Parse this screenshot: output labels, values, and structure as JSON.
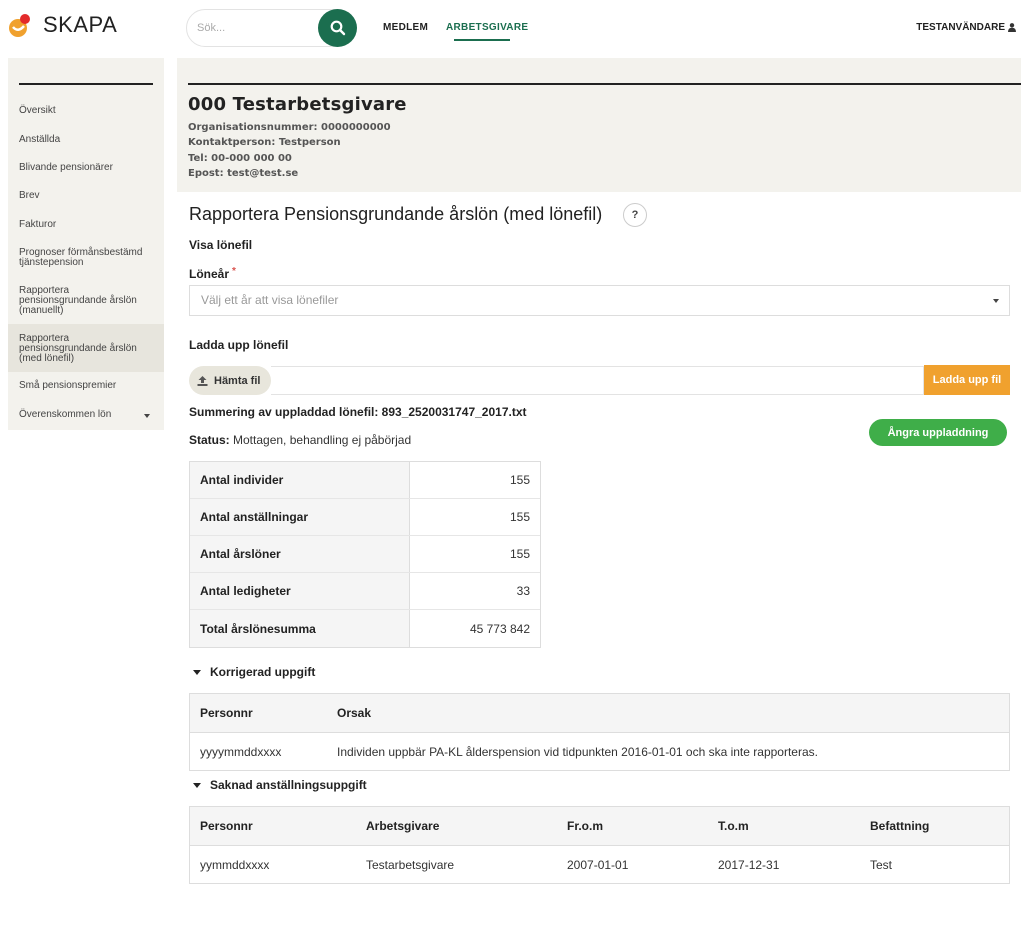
{
  "header": {
    "brand": "SKAPA",
    "search_placeholder": "Sök...",
    "nav": [
      {
        "label": "MEDLEM"
      },
      {
        "label": "ARBETSGIVARE"
      }
    ],
    "user": "TESTANVÄNDARE",
    "colors": {
      "primary": "#1b6e4f",
      "logo_orange": "#f0a12e",
      "logo_red": "#e32b2b"
    }
  },
  "sidebar": {
    "items": [
      {
        "label": "Översikt"
      },
      {
        "label": "Anställda"
      },
      {
        "label": "Blivande pensionärer"
      },
      {
        "label": "Brev"
      },
      {
        "label": "Fakturor"
      },
      {
        "label": "Prognoser förmånsbestämd tjänstepension"
      },
      {
        "label": "Rapportera pensionsgrundande årslön (manuellt)"
      },
      {
        "label": "Rapportera pensionsgrundande årslön (med lönefil)"
      },
      {
        "label": "Små pensionspremier"
      },
      {
        "label": "Överenskommen lön"
      }
    ]
  },
  "employer": {
    "title": "000 Testarbetsgivare",
    "org": "Organisationsnummer: 0000000000",
    "contact": "Kontaktperson: Testperson",
    "tel": "Tel: 00-000 000 00",
    "email": "Epost: test@test.se"
  },
  "main": {
    "title": "Rapportera Pensionsgrundande årslön (med lönefil)",
    "help": "?",
    "view_heading": "Visa lönefil",
    "year_label": "Löneår",
    "required_mark": "*",
    "year_placeholder": "Välj ett år att visa lönefiler",
    "upload_heading": "Ladda upp lönefil",
    "browse_label": "Hämta fil",
    "upload_label": "Ladda upp fil",
    "summary": "Summering av uppladdad lönefil: 893_2520031747_2017.txt",
    "status_label": "Status:",
    "status_value": "Mottagen, behandling ej påbörjad",
    "undo_label": "Ångra uppladdning",
    "stats": [
      {
        "key": "Antal individer",
        "value": "155"
      },
      {
        "key": "Antal anställningar",
        "value": "155"
      },
      {
        "key": "Antal årslöner",
        "value": "155"
      },
      {
        "key": "Antal ledigheter",
        "value": "33"
      },
      {
        "key": "Total årslönesumma",
        "value": "45 773 842"
      }
    ],
    "corrected": {
      "heading": "Korrigerad uppgift",
      "columns": [
        "Personnr",
        "Orsak"
      ],
      "rows": [
        [
          "yyyymmddxxxx",
          "Individen uppbär PA-KL ålderspension vid tidpunkten 2016-01-01 och ska inte rapporteras."
        ]
      ]
    },
    "missing": {
      "heading": "Saknad anställningsuppgift",
      "columns": [
        "Personnr",
        "Arbetsgivare",
        "Fr.o.m",
        "T.o.m",
        "Befattning"
      ],
      "rows": [
        [
          "yymmddxxxx",
          "Testarbetsgivare",
          "2007-01-01",
          "2017-12-31",
          "Test"
        ]
      ]
    }
  }
}
